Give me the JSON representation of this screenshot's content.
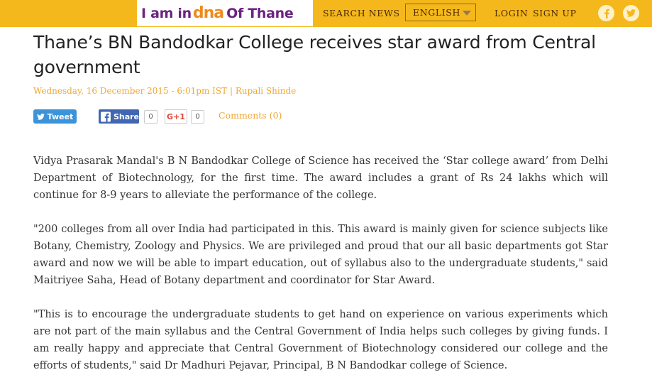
{
  "header": {
    "logo": {
      "pre": "I am in",
      "dna": "dna",
      "post": "Of Thane"
    },
    "search_news": "SEARCH NEWS",
    "language": "ENGLISH",
    "login": "LOGIN",
    "signup": "SIGN UP",
    "social": {
      "facebook_glyph": "f",
      "twitter_glyph": "🐦"
    }
  },
  "article": {
    "title": "Thane’s BN Bandodkar College receives star award from Central government",
    "date": "Wednesday, 16 December 2015 - 6:01pm IST",
    "separator": "|",
    "author": "Rupali Shinde",
    "share": {
      "tweet_label": "Tweet",
      "share_label": "Share",
      "share_count": "0",
      "gplus_label": "G+1",
      "gplus_count": "0",
      "comments_label": "Comments (0)"
    },
    "paragraphs": [
      "Vidya Prasarak Mandal's B N Bandodkar College of Science has received the ‘Star college award’ from Delhi Department of Biotechnology, for the first time. The award includes a grant of Rs 24 lakhs which will continue for 8-9 years to alleviate the performance of the college.",
      "\"200 colleges from all over India had participated in this. This award is mainly given for science subjects like Botany, Chemistry, Zoology and Physics. We are privileged and proud that our all basic departments got Star award and now we will be able to impart education, out of syllabus also to the undergraduate students,\" said Maitriyee Saha, Head of Botany department and coordinator for Star Award.",
      "\"This is to encourage the undergraduate students to get hand on experience on various experiments which are not part of the main syllabus and the Central Government of India helps such colleges by giving funds. I am really happy and appreciate that Central Government of Biotechnology considered our college and the efforts of students,\" said Dr Madhuri Pejavar, Principal, B N Bandodkar college of Science."
    ]
  },
  "colors": {
    "topbar": "#f5b81c",
    "brand_purple": "#6b2380",
    "dna_orange": "#f08a1c",
    "meta_orange": "#f0a830",
    "twitter_blue": "#3b94d9",
    "facebook_blue": "#4267b2"
  }
}
